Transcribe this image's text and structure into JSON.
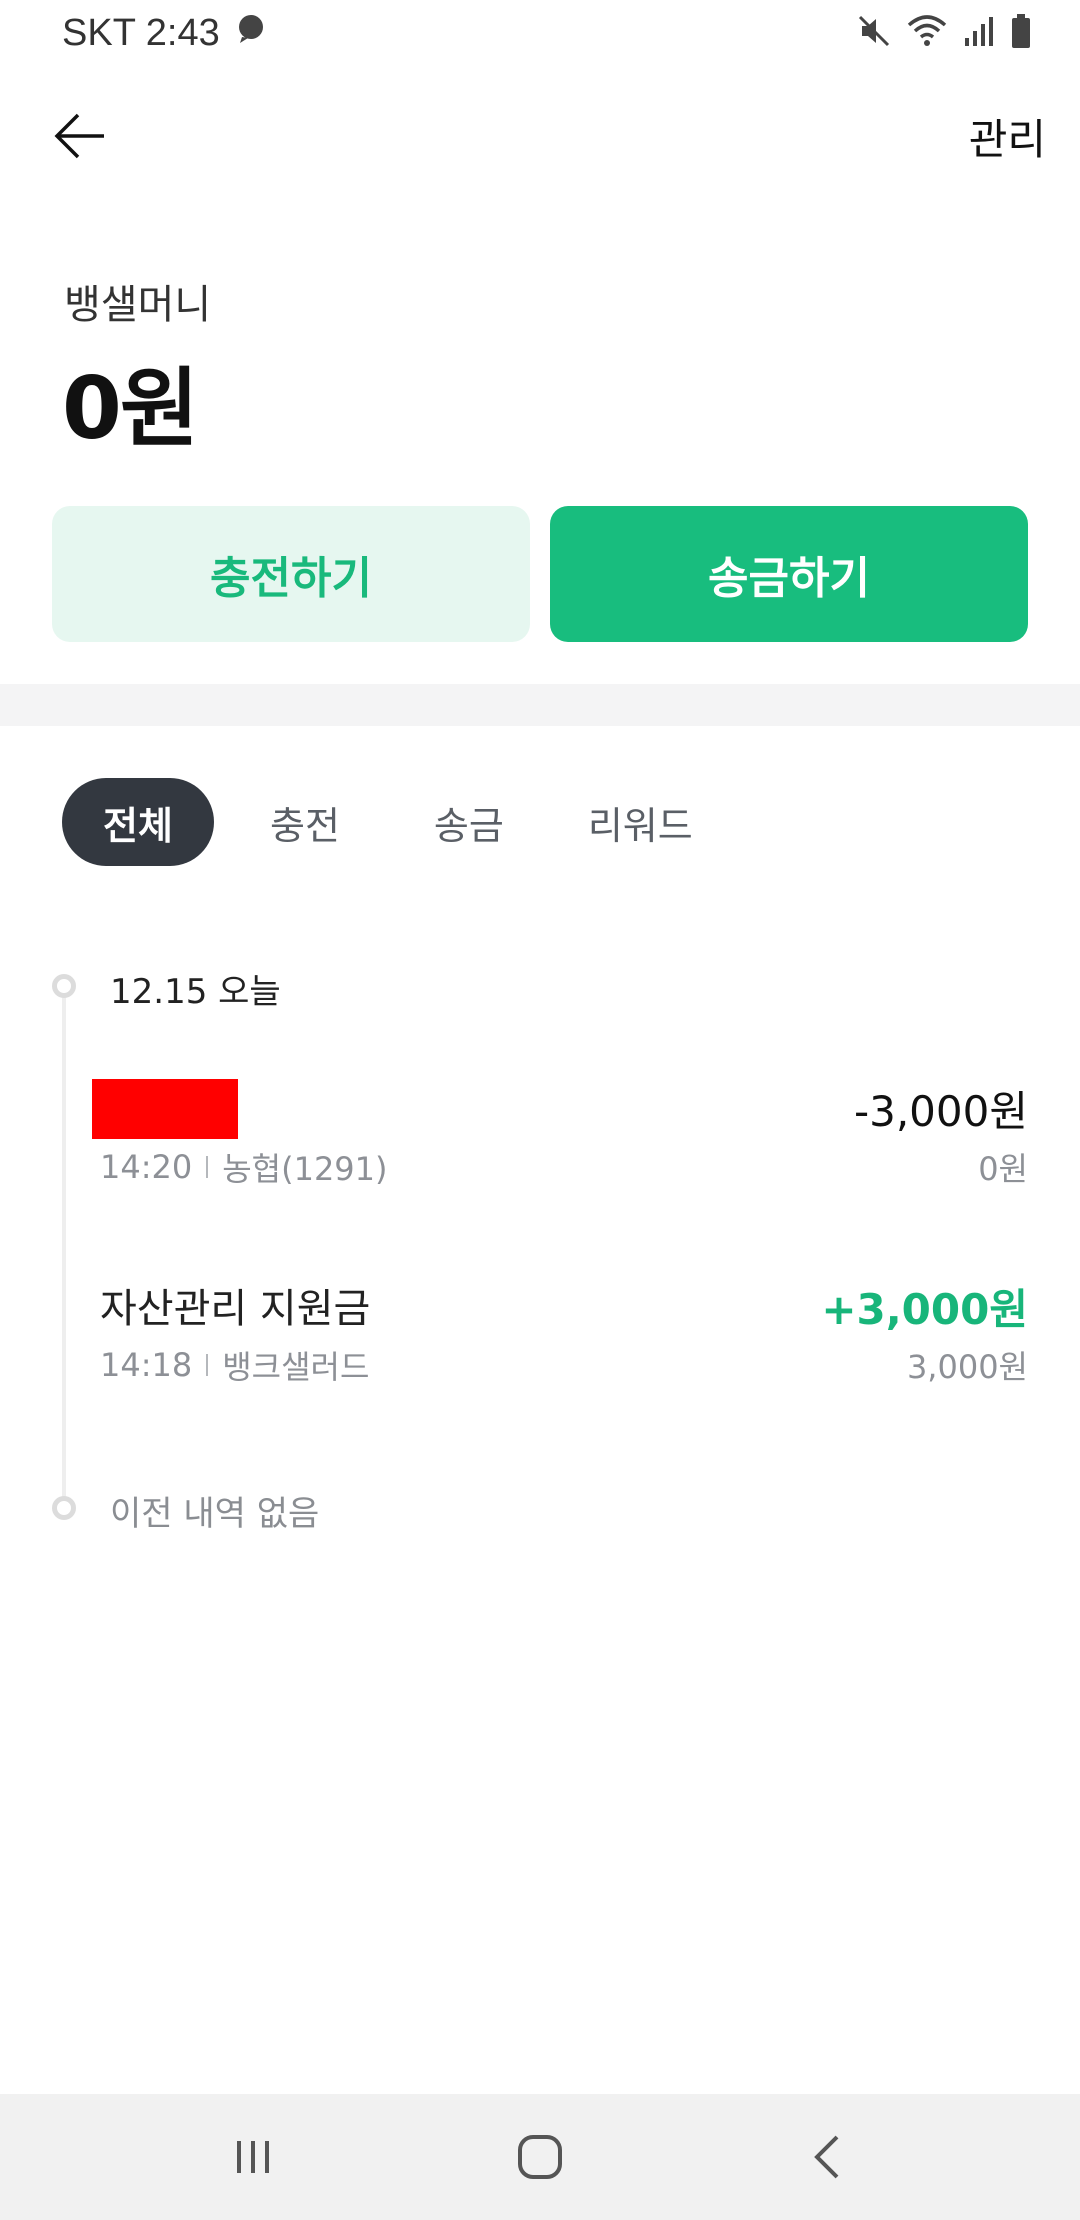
{
  "status_bar": {
    "carrier_time": "SKT 2:43",
    "icons": [
      "chat-bubble-icon",
      "mute-icon",
      "wifi-icon",
      "signal-icon",
      "battery-icon"
    ]
  },
  "header": {
    "manage_label": "관리"
  },
  "balance": {
    "label": "뱅샐머니",
    "amount": "0원"
  },
  "actions": {
    "charge_label": "충전하기",
    "send_label": "송금하기"
  },
  "tabs": [
    {
      "label": "전체",
      "active": true
    },
    {
      "label": "충전",
      "active": false
    },
    {
      "label": "송금",
      "active": false
    },
    {
      "label": "리워드",
      "active": false
    }
  ],
  "timeline": {
    "date_label": "12.15 오늘",
    "transactions": [
      {
        "name": "",
        "name_redacted": true,
        "time": "14:20",
        "source": "농협(1291)",
        "amount": "-3,000원",
        "balance_after": "0원",
        "type": "minus"
      },
      {
        "name": "자산관리 지원금",
        "name_redacted": false,
        "time": "14:18",
        "source": "뱅크샐러드",
        "amount": "+3,000원",
        "balance_after": "3,000원",
        "type": "plus"
      }
    ],
    "empty_label": "이전 내역 없음"
  },
  "colors": {
    "accent_green": "#18bd7e",
    "accent_green_light": "#e6f7f0",
    "active_tab": "#333840",
    "redaction": "#ff0000"
  }
}
